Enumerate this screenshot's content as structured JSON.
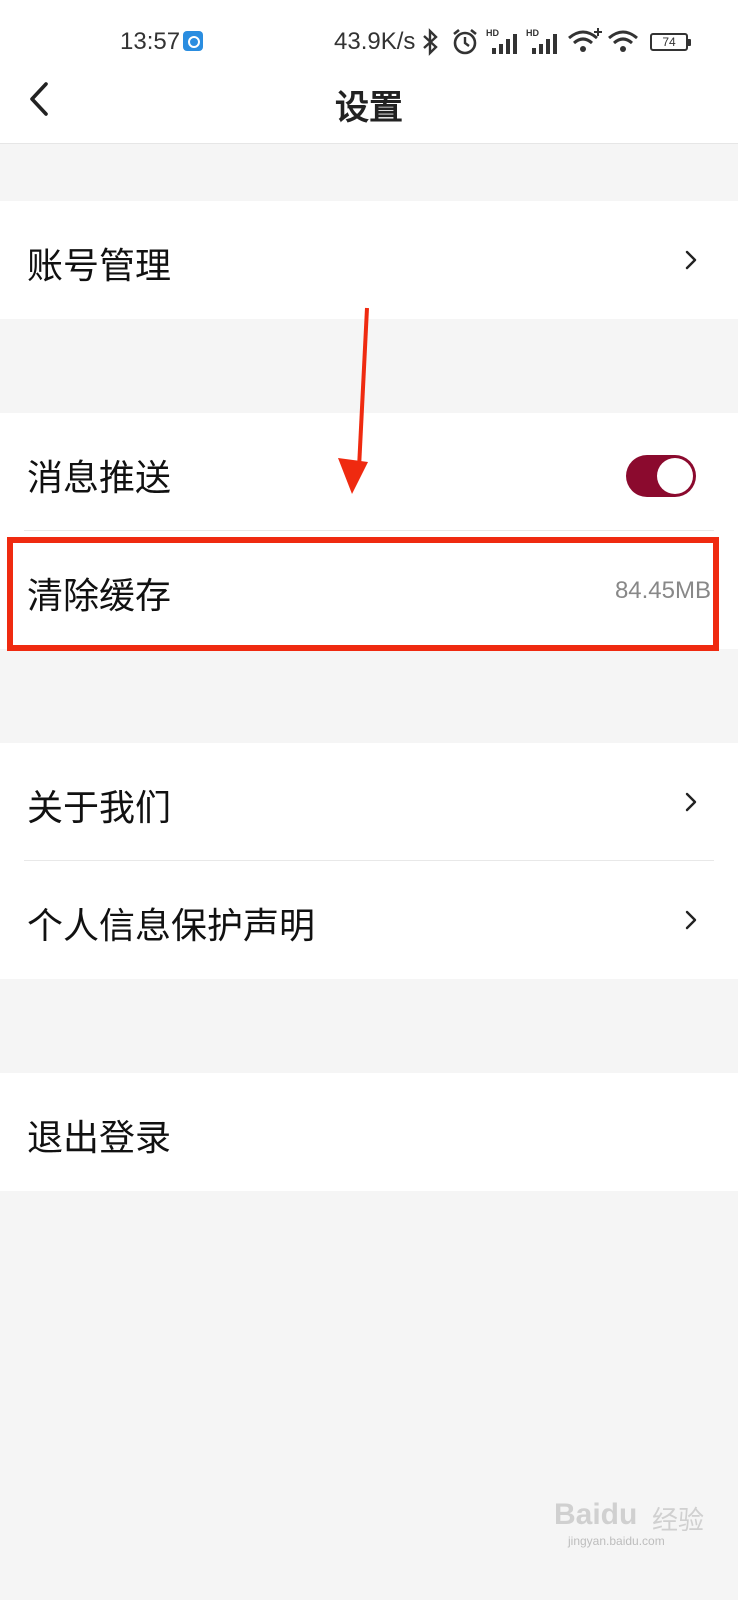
{
  "status_bar": {
    "time": "13:57",
    "network_speed": "43.9K/s",
    "battery_level": "74",
    "icons": [
      "app-notification-icon",
      "bluetooth-icon",
      "alarm-icon",
      "hd-signal-icon",
      "hd-signal-icon",
      "wifi-icon",
      "wifi-icon",
      "battery-icon"
    ]
  },
  "nav": {
    "title": "设置",
    "back_icon": "chevron-left-icon"
  },
  "settings": {
    "account": {
      "label": "账号管理",
      "icon": "chevron-right-icon"
    },
    "push": {
      "label": "消息推送",
      "toggle_on": true,
      "toggle_color": "#8b0a2e"
    },
    "cache": {
      "label": "清除缓存",
      "size": "84.45MB"
    },
    "about": {
      "label": "关于我们",
      "icon": "chevron-right-icon"
    },
    "privacy": {
      "label": "个人信息保护声明",
      "icon": "chevron-right-icon"
    },
    "logout": {
      "label": "退出登录"
    }
  },
  "annotation": {
    "highlight_color": "#ef2a10",
    "arrow_color": "#ef2a10"
  },
  "watermark": {
    "brand": "Baidu",
    "text": "经验",
    "url": "jingyan.baidu.com"
  }
}
